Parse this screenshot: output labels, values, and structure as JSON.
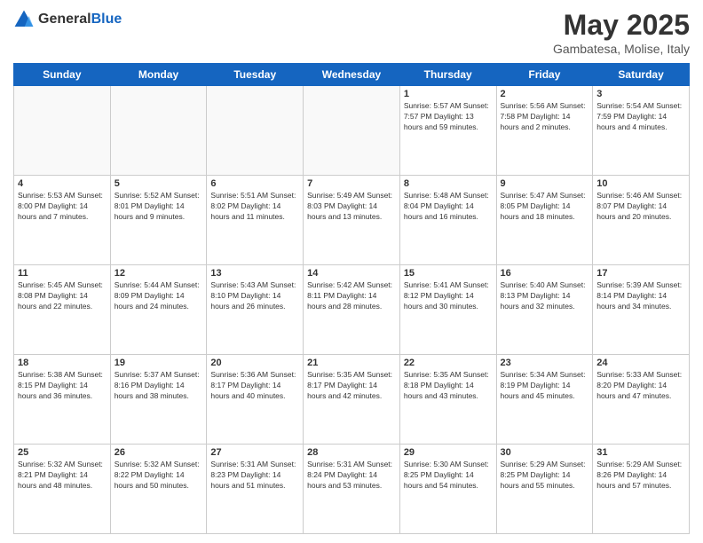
{
  "header": {
    "logo_general": "General",
    "logo_blue": "Blue",
    "title": "May 2025",
    "location": "Gambatesa, Molise, Italy"
  },
  "days_of_week": [
    "Sunday",
    "Monday",
    "Tuesday",
    "Wednesday",
    "Thursday",
    "Friday",
    "Saturday"
  ],
  "weeks": [
    [
      {
        "day": "",
        "info": ""
      },
      {
        "day": "",
        "info": ""
      },
      {
        "day": "",
        "info": ""
      },
      {
        "day": "",
        "info": ""
      },
      {
        "day": "1",
        "info": "Sunrise: 5:57 AM\nSunset: 7:57 PM\nDaylight: 13 hours\nand 59 minutes."
      },
      {
        "day": "2",
        "info": "Sunrise: 5:56 AM\nSunset: 7:58 PM\nDaylight: 14 hours\nand 2 minutes."
      },
      {
        "day": "3",
        "info": "Sunrise: 5:54 AM\nSunset: 7:59 PM\nDaylight: 14 hours\nand 4 minutes."
      }
    ],
    [
      {
        "day": "4",
        "info": "Sunrise: 5:53 AM\nSunset: 8:00 PM\nDaylight: 14 hours\nand 7 minutes."
      },
      {
        "day": "5",
        "info": "Sunrise: 5:52 AM\nSunset: 8:01 PM\nDaylight: 14 hours\nand 9 minutes."
      },
      {
        "day": "6",
        "info": "Sunrise: 5:51 AM\nSunset: 8:02 PM\nDaylight: 14 hours\nand 11 minutes."
      },
      {
        "day": "7",
        "info": "Sunrise: 5:49 AM\nSunset: 8:03 PM\nDaylight: 14 hours\nand 13 minutes."
      },
      {
        "day": "8",
        "info": "Sunrise: 5:48 AM\nSunset: 8:04 PM\nDaylight: 14 hours\nand 16 minutes."
      },
      {
        "day": "9",
        "info": "Sunrise: 5:47 AM\nSunset: 8:05 PM\nDaylight: 14 hours\nand 18 minutes."
      },
      {
        "day": "10",
        "info": "Sunrise: 5:46 AM\nSunset: 8:07 PM\nDaylight: 14 hours\nand 20 minutes."
      }
    ],
    [
      {
        "day": "11",
        "info": "Sunrise: 5:45 AM\nSunset: 8:08 PM\nDaylight: 14 hours\nand 22 minutes."
      },
      {
        "day": "12",
        "info": "Sunrise: 5:44 AM\nSunset: 8:09 PM\nDaylight: 14 hours\nand 24 minutes."
      },
      {
        "day": "13",
        "info": "Sunrise: 5:43 AM\nSunset: 8:10 PM\nDaylight: 14 hours\nand 26 minutes."
      },
      {
        "day": "14",
        "info": "Sunrise: 5:42 AM\nSunset: 8:11 PM\nDaylight: 14 hours\nand 28 minutes."
      },
      {
        "day": "15",
        "info": "Sunrise: 5:41 AM\nSunset: 8:12 PM\nDaylight: 14 hours\nand 30 minutes."
      },
      {
        "day": "16",
        "info": "Sunrise: 5:40 AM\nSunset: 8:13 PM\nDaylight: 14 hours\nand 32 minutes."
      },
      {
        "day": "17",
        "info": "Sunrise: 5:39 AM\nSunset: 8:14 PM\nDaylight: 14 hours\nand 34 minutes."
      }
    ],
    [
      {
        "day": "18",
        "info": "Sunrise: 5:38 AM\nSunset: 8:15 PM\nDaylight: 14 hours\nand 36 minutes."
      },
      {
        "day": "19",
        "info": "Sunrise: 5:37 AM\nSunset: 8:16 PM\nDaylight: 14 hours\nand 38 minutes."
      },
      {
        "day": "20",
        "info": "Sunrise: 5:36 AM\nSunset: 8:17 PM\nDaylight: 14 hours\nand 40 minutes."
      },
      {
        "day": "21",
        "info": "Sunrise: 5:35 AM\nSunset: 8:17 PM\nDaylight: 14 hours\nand 42 minutes."
      },
      {
        "day": "22",
        "info": "Sunrise: 5:35 AM\nSunset: 8:18 PM\nDaylight: 14 hours\nand 43 minutes."
      },
      {
        "day": "23",
        "info": "Sunrise: 5:34 AM\nSunset: 8:19 PM\nDaylight: 14 hours\nand 45 minutes."
      },
      {
        "day": "24",
        "info": "Sunrise: 5:33 AM\nSunset: 8:20 PM\nDaylight: 14 hours\nand 47 minutes."
      }
    ],
    [
      {
        "day": "25",
        "info": "Sunrise: 5:32 AM\nSunset: 8:21 PM\nDaylight: 14 hours\nand 48 minutes."
      },
      {
        "day": "26",
        "info": "Sunrise: 5:32 AM\nSunset: 8:22 PM\nDaylight: 14 hours\nand 50 minutes."
      },
      {
        "day": "27",
        "info": "Sunrise: 5:31 AM\nSunset: 8:23 PM\nDaylight: 14 hours\nand 51 minutes."
      },
      {
        "day": "28",
        "info": "Sunrise: 5:31 AM\nSunset: 8:24 PM\nDaylight: 14 hours\nand 53 minutes."
      },
      {
        "day": "29",
        "info": "Sunrise: 5:30 AM\nSunset: 8:25 PM\nDaylight: 14 hours\nand 54 minutes."
      },
      {
        "day": "30",
        "info": "Sunrise: 5:29 AM\nSunset: 8:25 PM\nDaylight: 14 hours\nand 55 minutes."
      },
      {
        "day": "31",
        "info": "Sunrise: 5:29 AM\nSunset: 8:26 PM\nDaylight: 14 hours\nand 57 minutes."
      }
    ]
  ]
}
